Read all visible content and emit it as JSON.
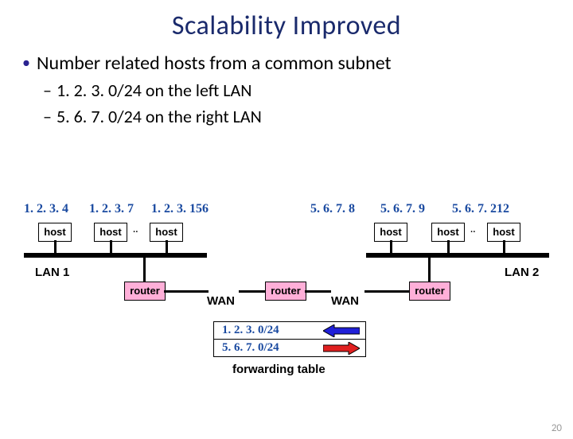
{
  "title": "Scalability Improved",
  "bullet": "Number related hosts from a common subnet",
  "sub1": "1. 2. 3. 0/24 on the left LAN",
  "sub2": "5. 6. 7. 0/24 on the right LAN",
  "left": {
    "ips": [
      "1. 2. 3. 4",
      "1. 2. 3. 7",
      "1. 2. 3. 156"
    ],
    "hostLabel": "host",
    "dots": "..",
    "lan": "LAN 1"
  },
  "right": {
    "ips": [
      "5. 6. 7. 8",
      "5. 6. 7. 9",
      "5. 6. 7. 212"
    ],
    "hostLabel": "host",
    "dots": "..",
    "lan": "LAN 2"
  },
  "routerLabel": "router",
  "wanLabel": "WAN",
  "fwd": {
    "r1": "1. 2. 3. 0/24",
    "r2": "5. 6. 7. 0/24",
    "caption": "forwarding table"
  },
  "pageNum": "20"
}
